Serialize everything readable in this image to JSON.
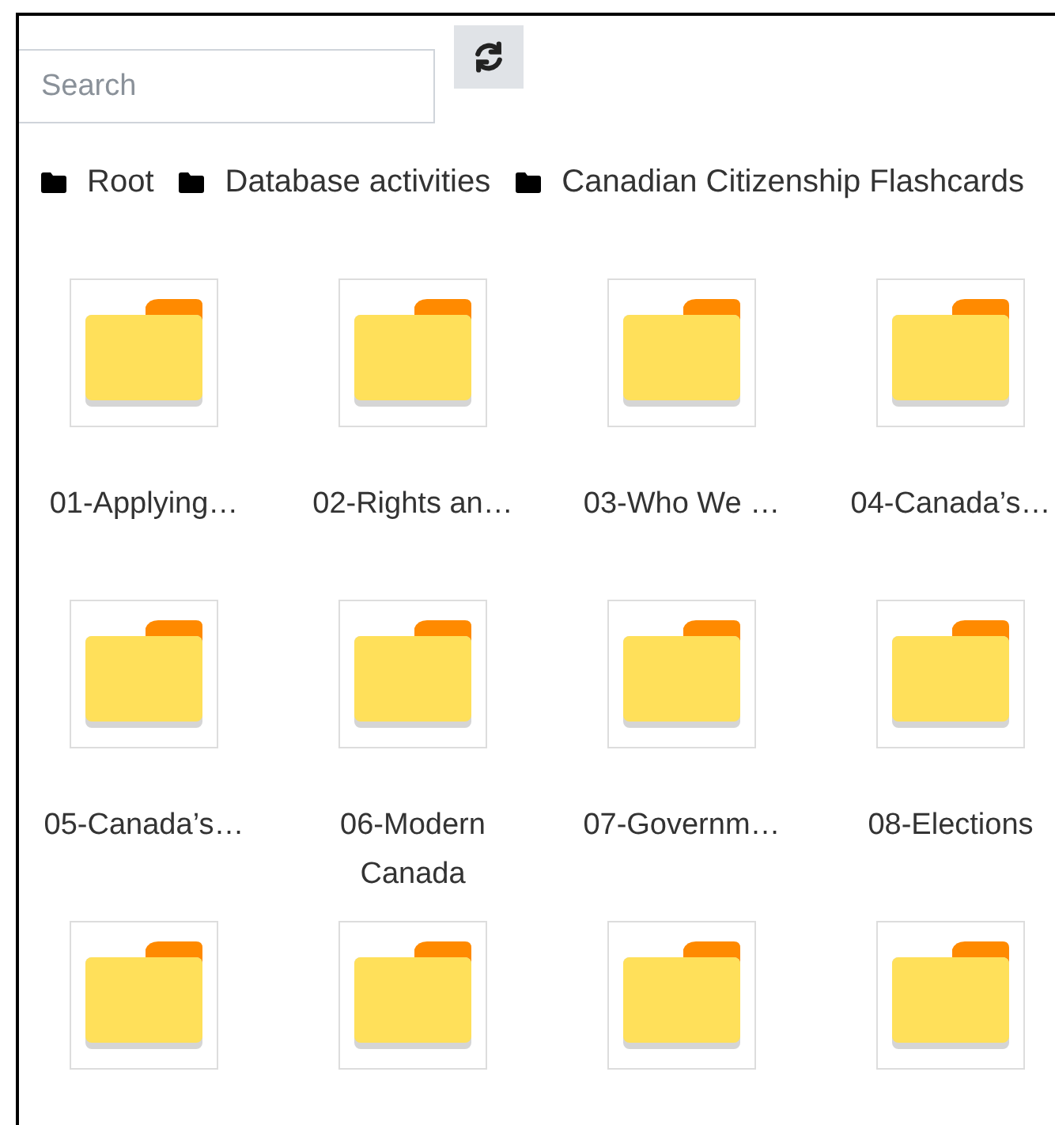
{
  "search": {
    "placeholder": "Search"
  },
  "breadcrumb": [
    "Root",
    "Database activities",
    "Canadian Citizenship Flashcards"
  ],
  "folders": [
    {
      "kind": "folder",
      "name": "01-Applying…"
    },
    {
      "kind": "folder",
      "name": "02-Rights an…"
    },
    {
      "kind": "folder",
      "name": "03-Who We …"
    },
    {
      "kind": "folder",
      "name": "04-Canada’s…"
    },
    {
      "kind": "folder",
      "name": "05-Canada’s…"
    },
    {
      "kind": "folder",
      "name": "06-Modern Canada"
    },
    {
      "kind": "folder",
      "name": "07-Governm…"
    },
    {
      "kind": "folder",
      "name": "08-Elections"
    },
    {
      "kind": "folder"
    },
    {
      "kind": "folder"
    },
    {
      "kind": "folder"
    },
    {
      "kind": "folder"
    }
  ]
}
